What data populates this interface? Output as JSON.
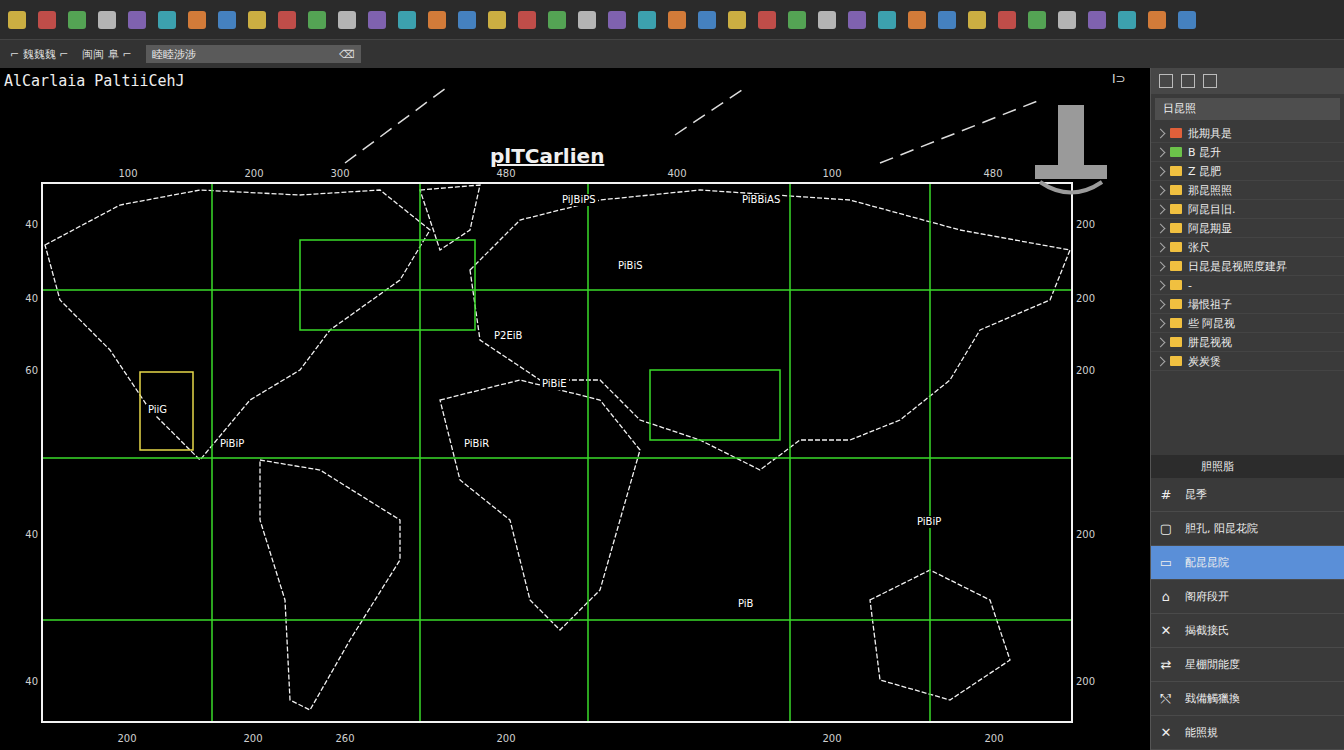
{
  "window": {
    "caption": "AlCarlaia PaltiiCehJ",
    "corner_mark": "I⊃"
  },
  "toolbar": {
    "labels": [
      "⌐ 魏魏魏 ⌐",
      "闽闽 阜 ⌐"
    ],
    "field": "睦睦涉涉",
    "field_icon": "⌫"
  },
  "canvas": {
    "title": "plTCarlien",
    "ticks_top": [
      "100",
      "200",
      "300",
      "480",
      "400",
      "100",
      "480"
    ],
    "ticks_bottom": [
      "200",
      "200",
      "260",
      "200",
      "200",
      "200"
    ],
    "ticks_left": [
      "40",
      "40",
      "60",
      "40",
      "40"
    ],
    "ticks_right": [
      "200",
      "200",
      "200",
      "200",
      "200"
    ],
    "map_labels": [
      "PiJBiPS",
      "PiBBiAS",
      "PiBiS",
      "P2EiB",
      "PiBiE",
      "PiiG",
      "PiBiP",
      "PiBiR",
      "PiB",
      "PiBiP"
    ]
  },
  "panel": {
    "dropdown": "日昆照",
    "tree": [
      {
        "label": "批期具是",
        "color": "#e0603a"
      },
      {
        "label": "B 昆升",
        "color": "#6cc24a"
      },
      {
        "label": "Z 昆肥",
        "color": "#f0c040"
      },
      {
        "label": "那昆照照",
        "color": "#f0c040"
      },
      {
        "label": "阿昆目旧.",
        "color": "#f0c040"
      },
      {
        "label": "阿昆期显",
        "color": "#f0c040"
      },
      {
        "label": "张尺",
        "color": "#f0c040"
      },
      {
        "label": "日昆是昆视照度建昇",
        "color": "#f0c040"
      },
      {
        "label": "-",
        "color": "#f0c040"
      },
      {
        "label": "場恨祖子",
        "color": "#f0c040"
      },
      {
        "label": "些 阿昆视",
        "color": "#f0c040"
      },
      {
        "label": "肼昆视视",
        "color": "#f0c040"
      },
      {
        "label": "炭炭煲",
        "color": "#f0c040"
      }
    ],
    "properties_title": "胆照脂",
    "properties": [
      {
        "icon": "#",
        "label": "昆季",
        "selected": false
      },
      {
        "icon": "▢",
        "label": "胆孔, 阳昆花院",
        "selected": false
      },
      {
        "icon": "▭",
        "label": "配昆昆院",
        "selected": true
      },
      {
        "icon": "⌂",
        "label": "阁府段开",
        "selected": false
      },
      {
        "icon": "✕",
        "label": "揭截接氏",
        "selected": false
      },
      {
        "icon": "⇄",
        "label": "星棚閒能度",
        "selected": false
      },
      {
        "icon": "⤲",
        "label": "戥備觸獵換",
        "selected": false
      },
      {
        "icon": "✕",
        "label": "能照規",
        "selected": false
      }
    ]
  }
}
